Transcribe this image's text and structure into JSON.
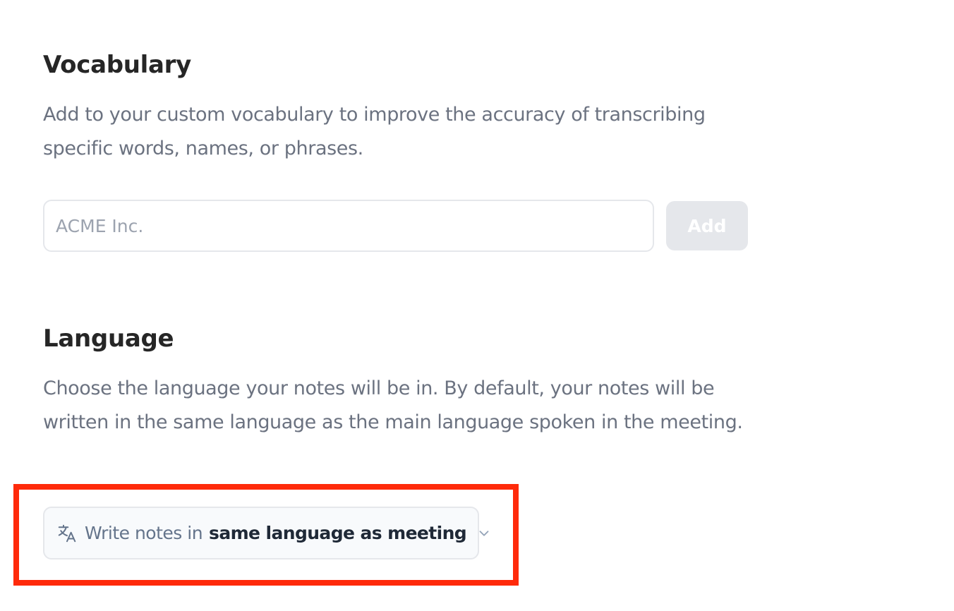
{
  "vocabulary": {
    "title": "Vocabulary",
    "description": "Add to your custom vocabulary to improve the accuracy of transcribing specific words, names, or phrases.",
    "input_placeholder": "ACME Inc.",
    "input_value": "",
    "add_button_label": "Add"
  },
  "language": {
    "title": "Language",
    "description": "Choose the language your notes will be in. By default, your notes will be written in the same language as the main language spoken in the meeting.",
    "select_prefix": "Write notes in",
    "select_value": "same language as meeting",
    "icon": "translate-icon"
  },
  "colors": {
    "highlight": "#ff2a0a",
    "heading": "#262626",
    "body_text": "#6b7280",
    "disabled_button": "#e5e7eb"
  }
}
